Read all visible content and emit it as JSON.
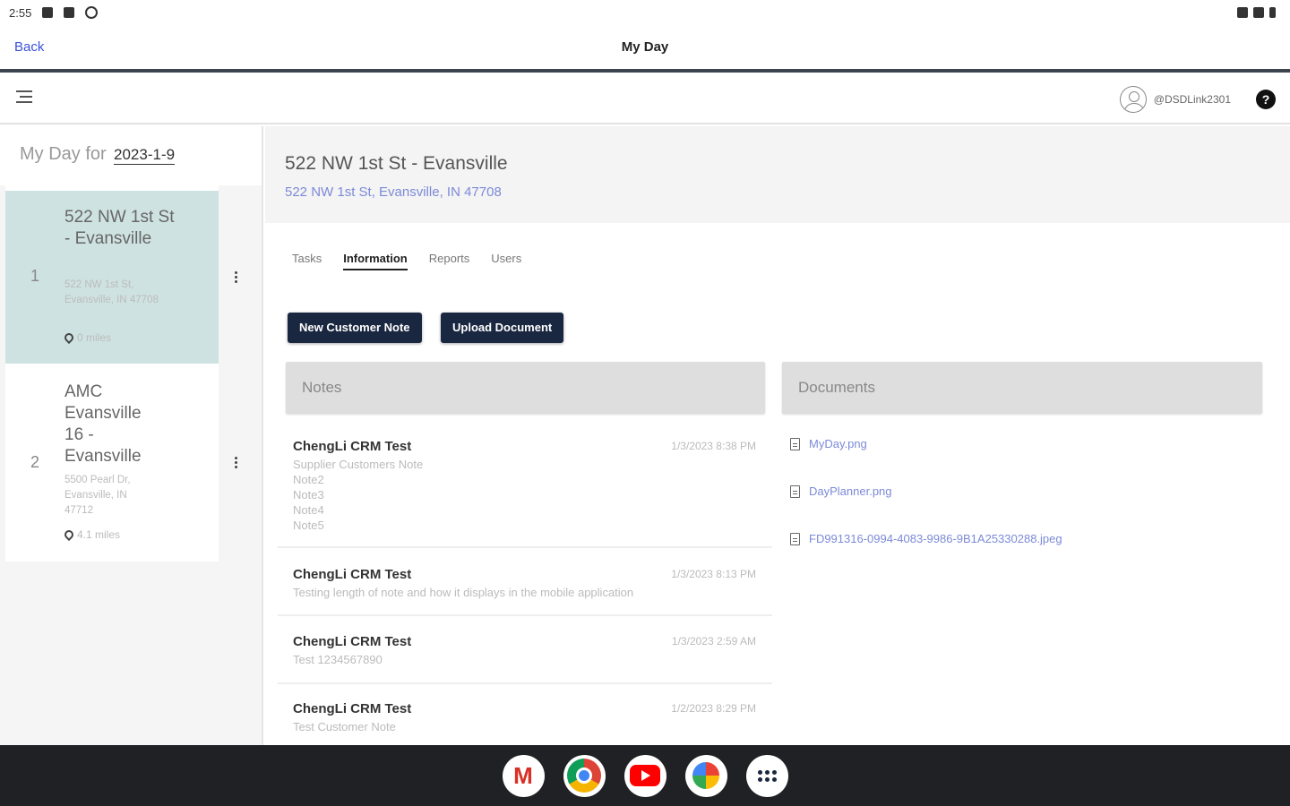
{
  "status_bar": {
    "time": "2:55"
  },
  "app_header": {
    "back_label": "Back",
    "title": "My Day"
  },
  "toolbar": {
    "username": "@DSDLink2301",
    "help_label": "?"
  },
  "day": {
    "label": "My Day for",
    "date": "2023-1-9"
  },
  "stops": [
    {
      "number": "1",
      "name": "522 NW 1st St - Evansville",
      "address": "522 NW 1st St, Evansville, IN 47708",
      "distance": "0 miles",
      "selected": true
    },
    {
      "number": "2",
      "name": "AMC Evansville 16 - Evansville",
      "address": "5500 Pearl Dr, Evansville, IN 47712",
      "distance": "4.1 miles",
      "selected": false
    }
  ],
  "location": {
    "title": "522 NW 1st St - Evansville",
    "address": "522 NW 1st St, Evansville, IN 47708"
  },
  "tabs": [
    {
      "label": "Tasks",
      "active": false
    },
    {
      "label": "Information",
      "active": true
    },
    {
      "label": "Reports",
      "active": false
    },
    {
      "label": "Users",
      "active": false
    }
  ],
  "buttons": {
    "new_note": "New Customer Note",
    "upload": "Upload Document"
  },
  "notes_section": {
    "title": "Notes",
    "items": [
      {
        "author": "ChengLi CRM Test",
        "time": "1/3/2023 8:38 PM",
        "body": "Supplier Customers Note\nNote2\nNote3\nNote4\nNote5"
      },
      {
        "author": "ChengLi CRM Test",
        "time": "1/3/2023 8:13 PM",
        "body": "Testing length of note and how it displays in the mobile application"
      },
      {
        "author": "ChengLi CRM Test",
        "time": "1/3/2023 2:59 AM",
        "body": "Test 1234567890"
      },
      {
        "author": "ChengLi CRM Test",
        "time": "1/2/2023 8:29 PM",
        "body": "Test Customer Note"
      }
    ]
  },
  "documents_section": {
    "title": "Documents",
    "items": [
      {
        "name": "MyDay.png"
      },
      {
        "name": "DayPlanner.png"
      },
      {
        "name": "FD991316-0994-4083-9986-9B1A25330288.jpeg"
      }
    ]
  },
  "taskbar": {
    "apps": [
      "gmail-icon",
      "chrome-icon",
      "youtube-icon",
      "photos-icon",
      "launcher-icon"
    ],
    "gmail_glyph": "M"
  },
  "colors": {
    "accent": "#1a2740",
    "link": "#7c8ad8",
    "selected_stop": "#cfe2e2",
    "back_link": "#3a52d8"
  }
}
